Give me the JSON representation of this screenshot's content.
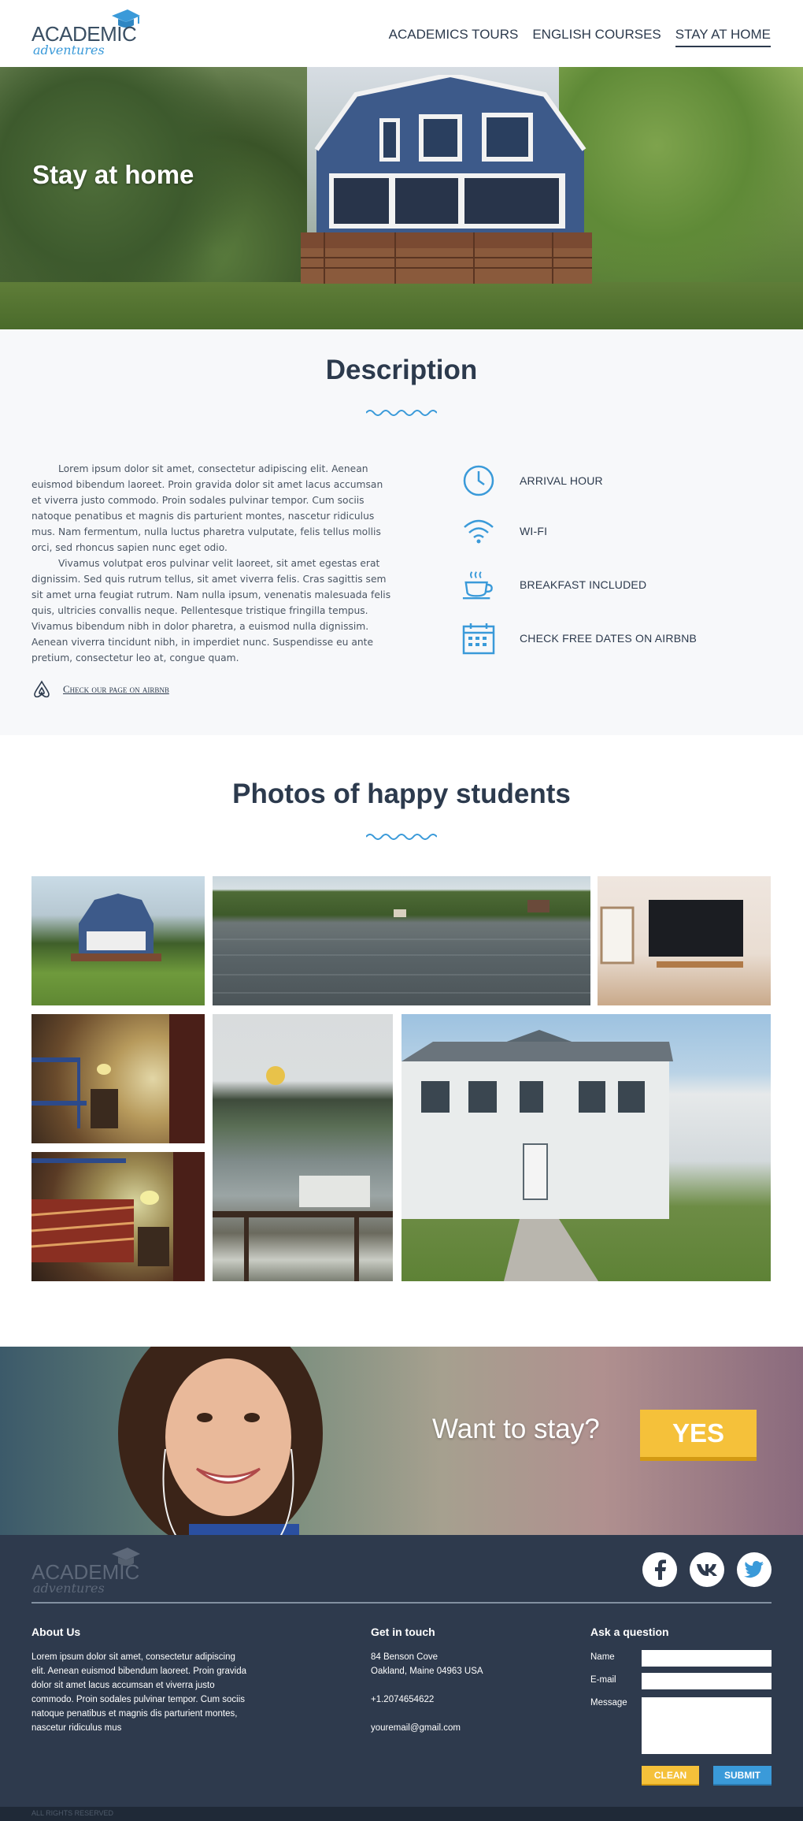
{
  "header": {
    "logo_top": "ACADEMIC",
    "logo_bottom": "adventures",
    "nav": [
      {
        "label": "ACADEMICS TOURS",
        "active": false
      },
      {
        "label": "ENGLISH COURSES",
        "active": false
      },
      {
        "label": "STAY AT HOME",
        "active": true
      }
    ]
  },
  "hero": {
    "title": "Stay at home"
  },
  "description": {
    "title": "Description",
    "paragraphs": [
      "Lorem ipsum dolor sit amet, consectetur adipiscing elit. Aenean euismod bibendum laoreet. Proin gravida dolor sit amet lacus accumsan et viverra justo commodo. Proin sodales pulvinar tempor. Cum sociis natoque penatibus et magnis dis parturient montes, nascetur ridiculus mus. Nam fermentum, nulla luctus pharetra vulputate, felis tellus mollis orci, sed rhoncus sapien nunc eget odio.",
      "Vivamus volutpat eros pulvinar velit laoreet, sit amet egestas erat dignissim. Sed quis rutrum tellus, sit amet viverra felis. Cras sagittis sem sit amet urna feugiat rutrum. Nam nulla ipsum, venenatis malesuada felis quis, ultricies convallis neque. Pellentesque tristique fringilla tempus. Vivamus bibendum nibh in dolor pharetra, a euismod nulla dignissim. Aenean viverra tincidunt nibh, in imperdiet nunc. Suspendisse eu ante pretium, consectetur leo at, congue quam."
    ],
    "airbnb_link": "Check our page on airbnb",
    "features": [
      {
        "icon": "clock-icon",
        "label": "ARRIVAL HOUR"
      },
      {
        "icon": "wifi-icon",
        "label": "WI-FI"
      },
      {
        "icon": "coffee-cup-icon",
        "label": "BREAKFAST INCLUDED"
      },
      {
        "icon": "calendar-icon",
        "label": "CHECK FREE DATES ON AIRBNB"
      }
    ]
  },
  "photos": {
    "title": "Photos of happy students"
  },
  "cta": {
    "text": "Want to stay?",
    "button": "YES"
  },
  "footer": {
    "logo_top": "ACADEMIC",
    "logo_bottom": "adventures",
    "socials": [
      "facebook-icon",
      "vk-icon",
      "twitter-icon"
    ],
    "about_title": "About Us",
    "about_text": "Lorem ipsum dolor sit amet, consectetur adipiscing elit. Aenean euismod bibendum laoreet. Proin gravida dolor sit amet lacus accumsan et viverra justo commodo. Proin sodales pulvinar tempor. Cum sociis natoque penatibus et magnis dis parturient montes, nascetur ridiculus mus",
    "contact_title": "Get in touch",
    "address_line1": "84 Benson Cove",
    "address_line2": "Oakland, Maine 04963 USA",
    "phone": "+1.2074654622",
    "email": "youremail@gmail.com",
    "form_title": "Ask a question",
    "name_label": "Name",
    "email_label": "E-mail",
    "message_label": "Message",
    "clean_button": "CLEAN",
    "submit_button": "SUBMIT",
    "copyright": "ALL RIGHTS RESERVED"
  },
  "colors": {
    "accent_blue": "#3a9ad9",
    "accent_yellow": "#f5c13a",
    "dark_navy": "#2e3a4d"
  }
}
